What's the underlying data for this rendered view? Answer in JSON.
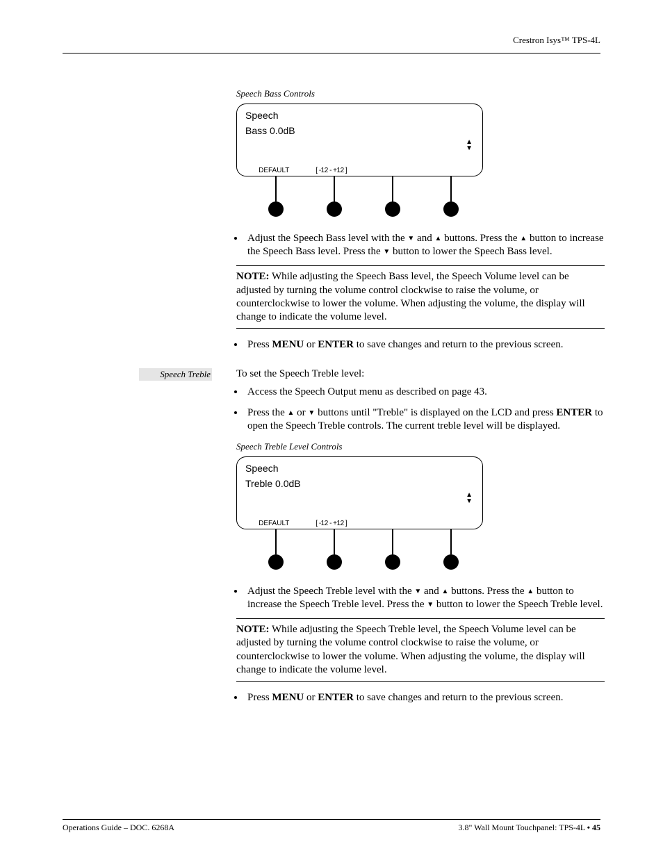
{
  "header": {
    "right": "Crestron Isys™ TPS-4L"
  },
  "section1": {
    "caption": "Speech Bass Controls",
    "lcd": {
      "line1": "Speech",
      "line2": "Bass         0.0dB",
      "sk1": "DEFAULT",
      "sk2": "[ -12 - +12 ]",
      "sk3": "",
      "sk4": ""
    },
    "bullets": {
      "b1": [
        "Adjust the Speech Bass level with the ",
        " and ",
        " buttons. Press the ",
        " button to increase the Speech Bass level. Press the ",
        " button to lower the Speech Bass level."
      ],
      "b2_pre": "Press ",
      "b2_menu": "MENU",
      "b2_or": " or ",
      "b2_enter": "ENTER",
      "b2_post": " to save changes and return to the previous screen."
    },
    "note": {
      "label": "NOTE:",
      "text": "  While adjusting the Speech Bass level, the Speech Volume level can be adjusted by turning the volume control clockwise to raise the volume, or counterclockwise to lower the volume. When adjusting the volume, the display will change to indicate the volume level."
    }
  },
  "section2": {
    "left_label": "Speech Treble",
    "intro": "To set the Speech Treble level:",
    "pre_bullets": {
      "b1": "Access the Speech Output menu as described on page 43.",
      "b2_parts": [
        "Press the ",
        " or ",
        " buttons until \"Treble\" is displayed on the LCD and press "
      ],
      "b2_enter": "ENTER",
      "b2_post": " to open the Speech Treble controls. The current treble level will be displayed."
    },
    "caption": "Speech Treble Level Controls",
    "lcd": {
      "line1": "Speech",
      "line2": "Treble       0.0dB",
      "sk1": "DEFAULT",
      "sk2": "[ -12 - +12 ]",
      "sk3": "",
      "sk4": ""
    },
    "bullets": {
      "b1": [
        "Adjust the Speech Treble level with the ",
        " and ",
        " buttons. Press the ",
        " button to increase the Speech Treble level. Press the ",
        " button to lower the Speech Treble level."
      ],
      "b2_pre": "Press ",
      "b2_menu": "MENU",
      "b2_or": " or ",
      "b2_enter": "ENTER",
      "b2_post": " to save changes and return to the previous screen."
    },
    "note": {
      "label": "NOTE:",
      "text": "  While adjusting the Speech Treble level, the Speech Volume level can be adjusted by turning the volume control clockwise to raise the volume, or counterclockwise to lower the volume. When adjusting the volume, the display will change to indicate the volume level."
    }
  },
  "footer": {
    "left": "Operations Guide – DOC. 6268A",
    "right_a": "3.8\" Wall Mount Touchpanel: TPS-4L ",
    "right_b": "•",
    "right_c": " 45"
  },
  "glyphs": {
    "up": "▲",
    "down": "▼"
  }
}
